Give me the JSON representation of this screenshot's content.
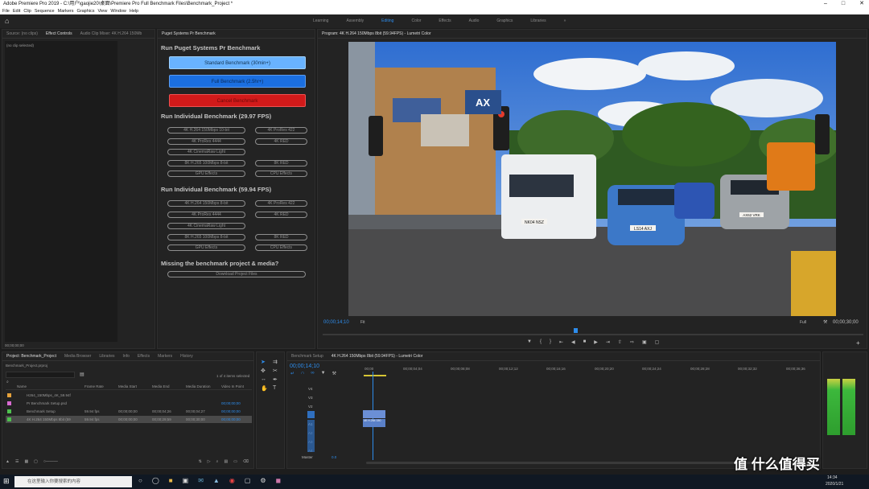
{
  "window": {
    "title": "Adobe Premiere Pro 2019 - C:\\用户\\gaojie20\\桌面\\Premiere Pro Full Benchmark Files\\Benchmark_Project *"
  },
  "menu": [
    "File",
    "Edit",
    "Clip",
    "Sequence",
    "Markers",
    "Graphics",
    "View",
    "Window",
    "Help"
  ],
  "workspaces": [
    "Learning",
    "Assembly",
    "Editing",
    "Color",
    "Effects",
    "Audio",
    "Graphics",
    "Libraries"
  ],
  "active_workspace": "Editing",
  "left_panel": {
    "tabs": [
      "Source: (no clips)",
      "Effect Controls",
      "Audio Clip Mixer: 4K H.264 150Mb"
    ],
    "no_clip": "(no clip selected)",
    "timecode": "00;00;00;00"
  },
  "plugin": {
    "tab": "Puget Systems Pr Benchmark",
    "h_run": "Run Puget Systems Pr Benchmark",
    "standard": "Standard Benchmark (30min+)",
    "full": "Full Benchmark (2.5hr+)",
    "cancel": "Cancel Benchmark",
    "h_2997": "Run Individual Benchmark (29.97 FPS)",
    "h_5994": "Run Individual Benchmark (59.94 FPS)",
    "h_missing": "Missing the benchmark project & media?",
    "download": "Download Project Files",
    "b1": [
      "4K H.264 150Mbps 10-bit",
      "4K ProRes 422",
      "4K ProRes 4444",
      "4K RED",
      "4K CinemaRaw Light",
      "8K H.265 100Mbps 8-bit",
      "8K RED",
      "GPU Effects",
      "CPU Effects"
    ],
    "b2": [
      "4K H.264 150Mbps 8-bit",
      "4K ProRes 422",
      "4K ProRes 4444",
      "4K RED",
      "4K CinemaRaw Light",
      "8K H.265 100Mbps 8-bit",
      "8K RED",
      "GPU Effects",
      "CPU Effects"
    ]
  },
  "program": {
    "tab": "Program: 4K H.264 150Mbps 8bit (59.94FPS) - Lumetri Color",
    "tc_left": "00;00;14;10",
    "fit": "Fit",
    "quality": "Full",
    "tc_right": "00;00;30;00",
    "plates": [
      "NK04 NSZ",
      "LS14 AXJ",
      "AX62 VRK"
    ],
    "sign": "AX"
  },
  "project": {
    "tabs": [
      "Project: Benchmark_Project",
      "Media Browser",
      "Libraries",
      "Info",
      "Effects",
      "Markers",
      "History"
    ],
    "path": "Benchmark_Project.prproj",
    "count": "1 of 4 items selected",
    "cols": [
      "Name",
      "Frame Rate",
      "Media Start",
      "Media End",
      "Media Duration",
      "Video In Point"
    ],
    "rows": [
      {
        "name": "H264_150Mbps_4K_59.94f",
        "fr": "",
        "ms": "",
        "me": "",
        "md": "",
        "vi": ""
      },
      {
        "name": "Pr Benchmark Setup.psd",
        "fr": "",
        "ms": "",
        "me": "",
        "md": "",
        "vi": "00;00;00;00"
      },
      {
        "name": "Benchmark Setup",
        "fr": "59.94 fps",
        "ms": "00;00;00;00",
        "me": "00;00;04;26",
        "md": "00;00;04;27",
        "vi": "00;00;00;00"
      },
      {
        "name": "4K H.264 150Mbps 8bit (59",
        "fr": "59.94 fps",
        "ms": "00;00;00;00",
        "me": "00;00;29;59",
        "md": "00;00;30;00",
        "vi": "00;00;00;00"
      }
    ]
  },
  "timeline": {
    "tabs": [
      "Benchmark Setup",
      "4K H.264 150Mbps 8bit (59.94FPS) - Lumetri Color"
    ],
    "tc": "00;00;14;10",
    "ruler": [
      "00;00",
      "00;00;04;04",
      "00;00;08;08",
      "00;00;12;12",
      "00;00;16;16",
      "00;00;20;20",
      "00;00;24;24",
      "00;00;28;28",
      "00;00;32;32",
      "00;00;36;36"
    ],
    "tracks": [
      "V4",
      "V3",
      "V2",
      "V1",
      "A1",
      "A2",
      "A3",
      "A4"
    ],
    "master": "Master",
    "master_val": "0.0",
    "clip": "4K H.264 150"
  },
  "taskbar": {
    "search": "在这里输入你要搜索的内容",
    "time": "14:34",
    "date": "2020/1/21",
    "watermark": "值 什么值得买"
  }
}
